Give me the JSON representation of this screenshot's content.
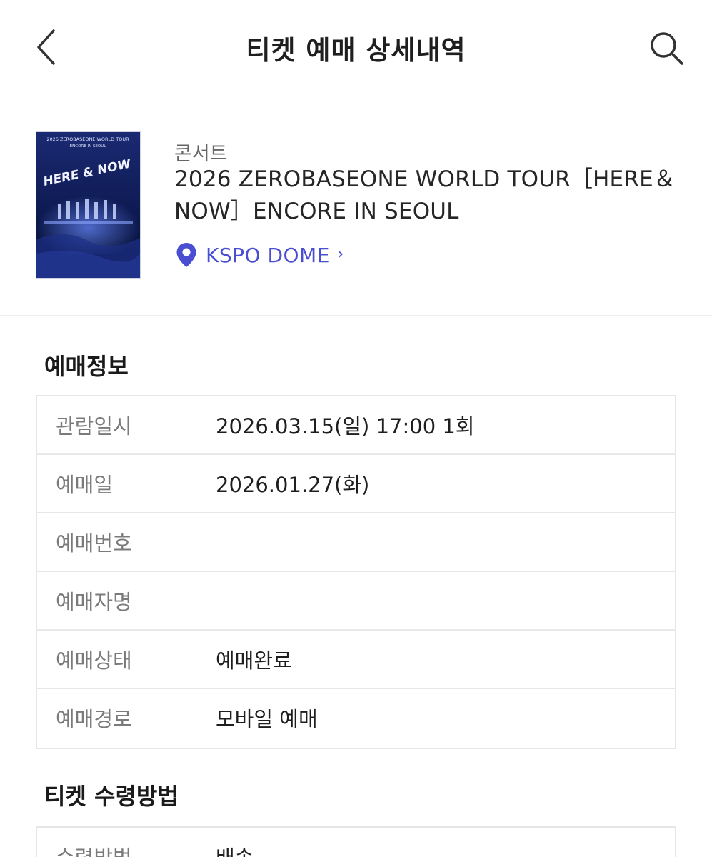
{
  "header": {
    "title": "티켓 예매 상세내역",
    "back_icon": "chevron-left-icon",
    "search_icon": "search-icon"
  },
  "event": {
    "category": "콘서트",
    "title": "2026 ZEROBASEONE WORLD TOUR［HERE＆NOW］ENCORE IN SEOUL",
    "venue": "KSPO DOME",
    "venue_chevron": "›",
    "venue_icon": "location-pin-icon",
    "accent_color": "#4a4fd1",
    "poster": {
      "line1": "2026 ZEROBASEONE WORLD TOUR",
      "line2": "ENCORE IN SEOUL",
      "logo": "HERE & NOW"
    }
  },
  "booking_info": {
    "section_title": "예매정보",
    "rows": [
      {
        "label": "관람일시",
        "value": "2026.03.15(일) 17:00 1회"
      },
      {
        "label": "예매일",
        "value": "2026.01.27(화)"
      },
      {
        "label": "예매번호",
        "value": ""
      },
      {
        "label": "예매자명",
        "value": ""
      },
      {
        "label": "예매상태",
        "value": "예매완료"
      },
      {
        "label": "예매경로",
        "value": "모바일 예매"
      }
    ]
  },
  "ticket_receipt": {
    "section_title": "티켓 수령방법",
    "rows": [
      {
        "label": "수령방법",
        "value": "배송"
      }
    ]
  }
}
